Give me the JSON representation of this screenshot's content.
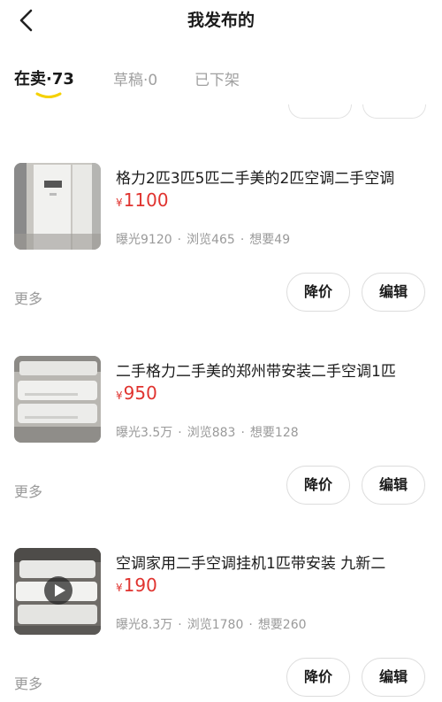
{
  "header": {
    "title": "我发布的"
  },
  "tabs": [
    {
      "label": "在卖·73",
      "active": true
    },
    {
      "label": "草稿·0",
      "active": false
    },
    {
      "label": "已下架",
      "active": false
    }
  ],
  "colors": {
    "price": "#e0332f",
    "tab_indicator": "#f5d100",
    "muted": "#9a9a9a"
  },
  "items": [
    {
      "title": "格力2匹3匹5匹二手美的2匹空调二手空调",
      "currency": "¥",
      "price": "1100",
      "exposure": "曝光9120",
      "views": "浏览465",
      "wants": "想要49",
      "more": "更多",
      "btn_price": "降价",
      "btn_edit": "编辑",
      "has_video": false
    },
    {
      "title": "二手格力二手美的郑州带安装二手空调1匹",
      "currency": "¥",
      "price": "950",
      "exposure": "曝光3.5万",
      "views": "浏览883",
      "wants": "想要128",
      "more": "更多",
      "btn_price": "降价",
      "btn_edit": "编辑",
      "has_video": false
    },
    {
      "title": "空调家用二手空调挂机1匹带安装 九新二",
      "currency": "¥",
      "price": "190",
      "exposure": "曝光8.3万",
      "views": "浏览1780",
      "wants": "想要260",
      "more": "更多",
      "btn_price": "降价",
      "btn_edit": "编辑",
      "has_video": true
    }
  ],
  "separator": "·"
}
